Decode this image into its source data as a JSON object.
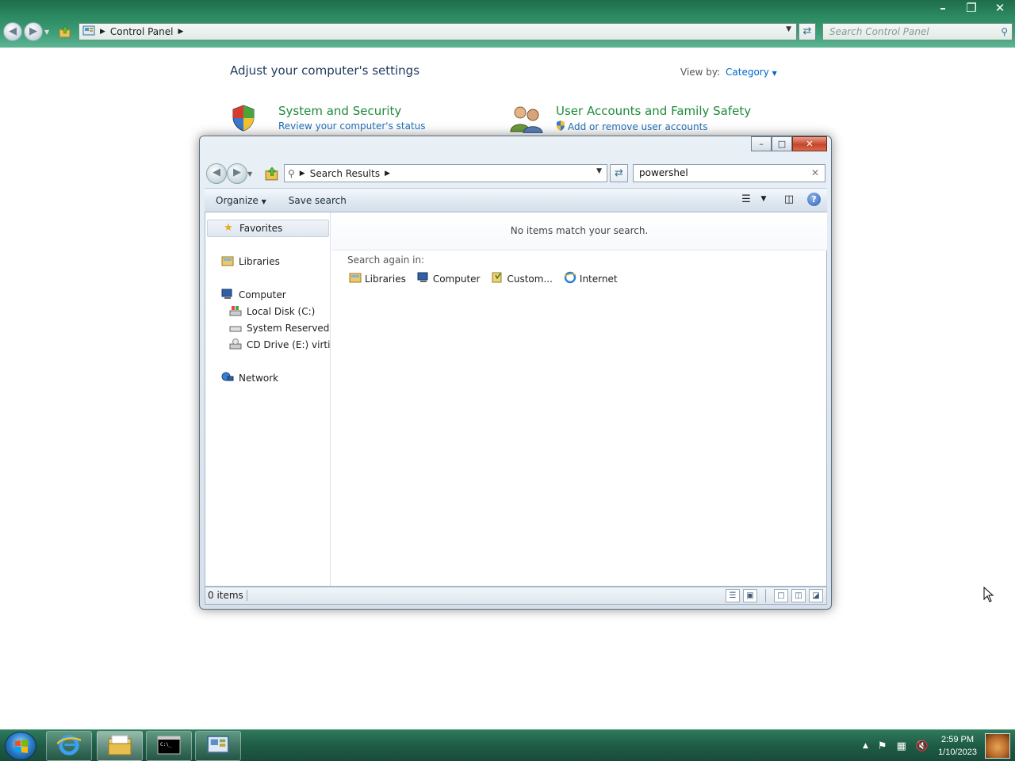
{
  "control_panel": {
    "address": {
      "crumb": "Control Panel"
    },
    "search_placeholder": "Search Control Panel",
    "heading": "Adjust your computer's settings",
    "view_by_label": "View by:",
    "view_by_value": "Category",
    "categories": [
      {
        "title": "System and Security",
        "link": "Review your computer's status"
      },
      {
        "title": "User Accounts and Family Safety",
        "link": "Add or remove user accounts"
      }
    ]
  },
  "explorer": {
    "address": {
      "crumb": "Search Results"
    },
    "search_value": "powershel",
    "toolbar": {
      "organize": "Organize",
      "save_search": "Save search"
    },
    "nav_pane": {
      "favorites": "Favorites",
      "libraries": "Libraries",
      "computer": "Computer",
      "drives": [
        "Local Disk (C:)",
        "System Reserved (D:",
        "CD Drive (E:) virtio-v"
      ],
      "network": "Network"
    },
    "content": {
      "no_items": "No items match your search.",
      "search_again_label": "Search again in:",
      "search_again": [
        "Libraries",
        "Computer",
        "Custom...",
        "Internet"
      ]
    },
    "status": {
      "count": "0 items"
    }
  },
  "taskbar": {
    "clock_time": "2:59 PM",
    "clock_date": "1/10/2023"
  }
}
